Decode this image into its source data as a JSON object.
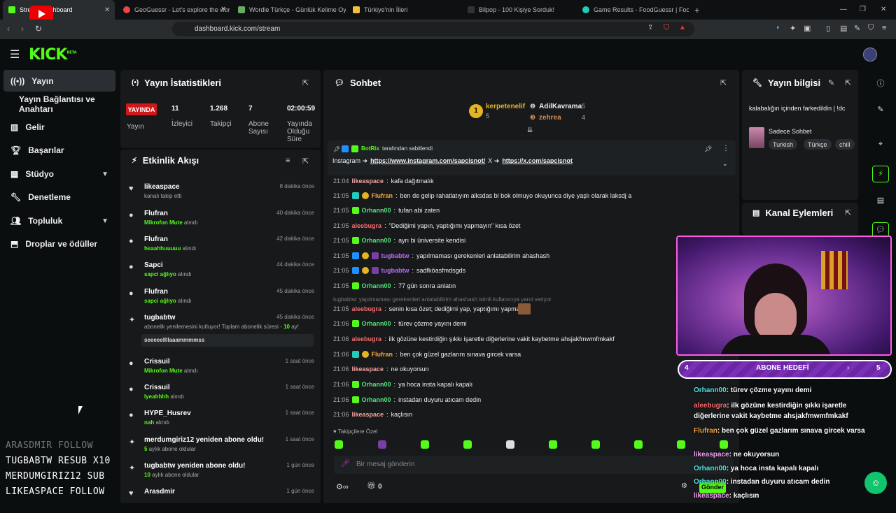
{
  "browser": {
    "tabs": [
      {
        "label": "Stream Dashboard",
        "color": "#53fc18"
      },
      {
        "label": "GeoGuessr - Let's explore the world!",
        "color": "#e44"
      },
      {
        "label": "Wordle Türkçe - Günlük Kelime Oyun",
        "color": "#6aaa64"
      },
      {
        "label": "Türkiye'nin İlleri",
        "color": "#f0c040"
      },
      {
        "label": "Bilpop - 100 Kişiye Sorduk!",
        "color": "#222"
      },
      {
        "label": "Game Results - FoodGuessr | FoodGu",
        "color": "#2cb"
      }
    ],
    "url": "dashboard.kick.com/stream"
  },
  "logo": "KICK",
  "logo_sup": "BETA",
  "sidebar": {
    "items": [
      {
        "label": "Yayın",
        "icon": "broadcast-icon"
      },
      {
        "label": "Yayın Bağlantısı ve Anahtarı",
        "icon": ""
      },
      {
        "label": "Gelir",
        "icon": "chart-icon"
      },
      {
        "label": "Başarılar",
        "icon": "trophy-icon"
      },
      {
        "label": "Stüdyo",
        "icon": "studio-icon"
      },
      {
        "label": "Denetleme",
        "icon": "wrench-icon"
      },
      {
        "label": "Topluluk",
        "icon": "community-icon"
      },
      {
        "label": "Droplar ve ödüller",
        "icon": "drops-icon"
      }
    ]
  },
  "stats": {
    "title": "Yayın İstatistikleri",
    "live": "YAYINDA",
    "live_label": "Yayın",
    "viewers": "11",
    "viewers_label": "İzleyici",
    "followers": "1.268",
    "followers_label": "Takipçi",
    "subs": "7",
    "subs_label": "Abone Sayısı",
    "duration": "02:00:59",
    "duration_label": "Yayında Olduğu Süre"
  },
  "activity": {
    "title": "Etkinlik Akışı",
    "events": [
      {
        "name": "likeaspace",
        "sub_pre": "",
        "sub_b": "",
        "sub_post": "kanalı takip etti",
        "time": "8 dakika önce"
      },
      {
        "name": "Flufran",
        "sub_pre": "",
        "sub_b": "Mikrofon Mute",
        "sub_post": " alındı",
        "time": "40 dakika önce"
      },
      {
        "name": "Flufran",
        "sub_pre": "",
        "sub_b": "heaahhuuuuu",
        "sub_post": " alındı",
        "time": "42 dakika önce"
      },
      {
        "name": "Sapci",
        "sub_pre": "",
        "sub_b": "sapci ağlıyo",
        "sub_post": " alındı",
        "time": "44 dakika önce"
      },
      {
        "name": "Flufran",
        "sub_pre": "",
        "sub_b": "sapci ağlıyo",
        "sub_post": " alındı",
        "time": "45 dakika önce"
      },
      {
        "name": "tugbabtw",
        "sub_pre": "abonelik yenilemesini kutluyor! Toplam abonelik süresi - ",
        "sub_b": "10",
        "sub_post": " ay!",
        "time": "45 dakika önce",
        "message": "seeeeellllaaammmmss"
      },
      {
        "name": "Crissuil",
        "sub_pre": "",
        "sub_b": "Mikrofon Mute",
        "sub_post": " alındı",
        "time": "1 saat önce"
      },
      {
        "name": "Crissuil",
        "sub_pre": "",
        "sub_b": "lyeahhhh",
        "sub_post": " alındı",
        "time": "1 saat önce"
      },
      {
        "name": "HYPE_Husrev",
        "sub_pre": "",
        "sub_b": "nah",
        "sub_post": " alındı",
        "time": "1 saat önce"
      },
      {
        "name": "merdumgiriz12 yeniden abone oldu!",
        "sub_pre": "",
        "sub_b": "5",
        "sub_post": " aylık abone oldular",
        "time": "1 saat önce"
      },
      {
        "name": "tugbabtw yeniden abone oldu!",
        "sub_pre": "",
        "sub_b": "10",
        "sub_post": " aylık abone oldular",
        "time": "1 gün önce"
      },
      {
        "name": "Arasdmir",
        "sub_pre": "",
        "sub_b": "",
        "sub_post": "",
        "time": "1 gün önce"
      }
    ]
  },
  "chat": {
    "title": "Sohbet",
    "top_gifters": [
      {
        "name": "kerpetenelif",
        "count": "5"
      },
      {
        "name": "AdilKavrama",
        "count": "5"
      },
      {
        "name": "zehrea",
        "count": "4"
      }
    ],
    "pinned_by": "BotRix",
    "pinned_suffix": "tarafından sabitlendi",
    "pinned_text": "Instagram ➜",
    "pinned_link1": "https://www.instagram.com/sapcisnot/",
    "pinned_mid": "X ➜",
    "pinned_link2": "https://x.com/sapcisnot",
    "messages": [
      {
        "time": "21:04",
        "user": "likeaspace",
        "color": "#f5a3a3",
        "text": "kafa dağıtmalık"
      },
      {
        "time": "21:05",
        "user": "Flufran",
        "color": "#f5a53a",
        "text": "ben de gelip rahatlatıyım alksdas bi bok olmuyo okuyunca diye yaşlı olarak laksdj a"
      },
      {
        "time": "21:05",
        "user": "Orhann00",
        "color": "#53e37a",
        "text": "tufan abi zaten"
      },
      {
        "time": "21:05",
        "user": "aleebugra",
        "color": "#f56d6d",
        "text": "\"Dediğimi yapın, yaptığımı yapmayın\" kısa özet"
      },
      {
        "time": "21:05",
        "user": "Orhann00",
        "color": "#53e37a",
        "text": "ayrı bi üniversite kendisi"
      },
      {
        "time": "21:05",
        "user": "tugbabtw",
        "color": "#b76cf5",
        "text": "yapılmaması gerekenleri anlatabilirim ahashash"
      },
      {
        "time": "21:05",
        "user": "tugbabtw",
        "color": "#b76cf5",
        "text": "sadfköasfmdsgds"
      },
      {
        "time": "21:05",
        "user": "Orhann00",
        "color": "#53e37a",
        "text": "77 gün sonra anlatın"
      },
      {
        "time": "21:05",
        "user": "aleebugra",
        "color": "#f56d6d",
        "text": "senin kısa özet; dediğimi yap, yaptığımı yapma"
      },
      {
        "time": "21:06",
        "user": "Orhann00",
        "color": "#53e37a",
        "text": "türev çözme yayını demi"
      },
      {
        "time": "21:06",
        "user": "aleebugra",
        "color": "#f56d6d",
        "text": "ilk gözüne kestirdiğin şıkkı işaretle diğerlerine vakit kaybetme ahsjakfmwmfmkakf"
      },
      {
        "time": "21:06",
        "user": "Flufran",
        "color": "#f5a53a",
        "text": "ben çok güzel gazlarım sınava gircek varsa"
      },
      {
        "time": "21:06",
        "user": "likeaspace",
        "color": "#f5a3a3",
        "text": "ne okuyorsun"
      },
      {
        "time": "21:06",
        "user": "Orhann00",
        "color": "#53e37a",
        "text": "ya hoca insta kapalı kapalı"
      },
      {
        "time": "21:06",
        "user": "Orhann00",
        "color": "#53e37a",
        "text": "instadan duyuru atıcam dedin"
      },
      {
        "time": "21:06",
        "user": "likeaspace",
        "color": "#f5a3a3",
        "text": "kaçlısın"
      }
    ],
    "reply_hint": "tugbabtw: yapılmaması gerekenleri anlatabilirim ahashash isimli kullanıcıya yanıt veriyor",
    "emote_section": "Takipçilere Özel",
    "input_placeholder": "Bir mesaj gönderin",
    "points": "0",
    "send_label": "Gönder"
  },
  "stream_info": {
    "title": "Yayın bilgisi",
    "stream_title": "kalabalığın içinden farkedildin | !dc",
    "category": "Sadece Sohbet",
    "tags": [
      "Turkish",
      "Türkçe",
      "chill"
    ]
  },
  "channel_actions": {
    "title": "Kanal Eylemleri"
  },
  "overlay": {
    "goal_label": "ABONE HEDEFİ",
    "goal_current": "4",
    "goal_target": "5",
    "chat": [
      {
        "user": "Orhann00",
        "color": "#53e3e3",
        "text": ": türev çözme yayını demi"
      },
      {
        "user": "aleebugra",
        "color": "#f56d6d",
        "text": ": ilk gözüne kestirdiğin şıkkı işaretle diğerlerine vakit kaybetme ahsjakfmwmfmkakf"
      },
      {
        "user": "Flufran",
        "color": "#f5a53a",
        "text": ": ben çok güzel gazlarım sınava gircek varsa"
      },
      {
        "user": "likeaspace",
        "color": "#f5a3f5",
        "text": ": ne okuyorsun"
      },
      {
        "user": "Orhann00",
        "color": "#53e3e3",
        "text": ": ya hoca insta kapalı kapalı"
      },
      {
        "user": "Orhann00",
        "color": "#53e3e3",
        "text": ": instadan duyuru atıcam dedin"
      },
      {
        "user": "likeaspace",
        "color": "#f5a3f5",
        "text": ": kaçlısın"
      }
    ],
    "recent_events": [
      {
        "text": "ARASDMIR  FOLLOW",
        "dim": true
      },
      {
        "text": "TUGBABTW  RESUB X10",
        "dim": false
      },
      {
        "text": "MERDUMGIRIZ12  SUB",
        "dim": false
      },
      {
        "text": "LIKEASPACE  FOLLOW",
        "dim": false
      }
    ]
  }
}
